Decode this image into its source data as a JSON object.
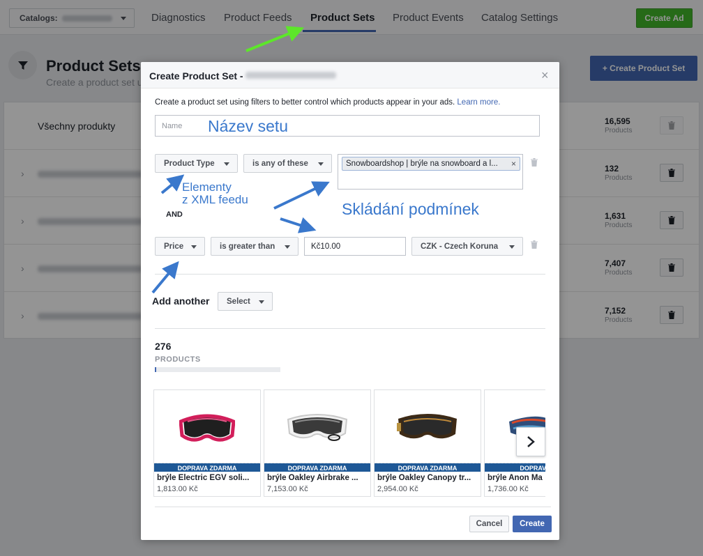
{
  "topbar": {
    "catalog_label": "Catalogs:",
    "tabs": [
      "Diagnostics",
      "Product Feeds",
      "Product Sets",
      "Product Events",
      "Catalog Settings"
    ],
    "active_tab": "Product Sets",
    "create_ad": "Create Ad"
  },
  "page": {
    "title": "Product Sets",
    "subtitle": "Create a product set u",
    "create_button": "+ Create Product Set",
    "rows": [
      {
        "name": "Všechny produkty",
        "count": "16,595",
        "count_label": "Products"
      },
      {
        "name": "",
        "count": "132",
        "count_label": "Products"
      },
      {
        "name": "",
        "count": "1,631",
        "count_label": "Products"
      },
      {
        "name": "",
        "count": "7,407",
        "count_label": "Products"
      },
      {
        "name": "",
        "count": "7,152",
        "count_label": "Products"
      }
    ]
  },
  "modal": {
    "title": "Create Product Set -",
    "close": "×",
    "intro": "Create a product set using filters to better control which products appear in your ads.",
    "learn_more": "Learn more.",
    "name_placeholder": "Name",
    "filter1": {
      "field": "Product Type",
      "operator": "is any of these",
      "tag": "Snowboardshop | brýle na snowboard a l...",
      "tag_remove": "×"
    },
    "and_label": "AND",
    "filter2": {
      "field": "Price",
      "operator": "is greater than",
      "value": "Kč10.00",
      "currency": "CZK - Czech Koruna"
    },
    "add_another": "Add another",
    "select": "Select",
    "product_count": "276",
    "products_label": "PRODUCTS",
    "products_progress": 0.012,
    "cards": [
      {
        "banner": "DOPRAVA ZDARMA",
        "title": "brýle Electric EGV soli...",
        "price": "1,813.00 Kč"
      },
      {
        "banner": "DOPRAVA ZDARMA",
        "title": "brýle Oakley Airbrake ...",
        "price": "7,153.00 Kč"
      },
      {
        "banner": "DOPRAVA ZDARMA",
        "title": "brýle Oakley Canopy tr...",
        "price": "2,954.00 Kč"
      },
      {
        "banner": "DOPRAVA Z",
        "title": "brýle Anon Ma",
        "price": "1,736.00 Kč"
      }
    ],
    "cancel": "Cancel",
    "create": "Create"
  },
  "annotations": {
    "set_name": "Název setu",
    "elements_line1": "Elementy",
    "elements_line2": "z XML feedu",
    "conditions": "Skládání podmínek"
  },
  "colors": {
    "accent": "#4267b2",
    "green": "#42b72a",
    "annotation_blue": "#3a78cc",
    "annotation_green": "#5de62a",
    "banner": "#1e5896"
  }
}
